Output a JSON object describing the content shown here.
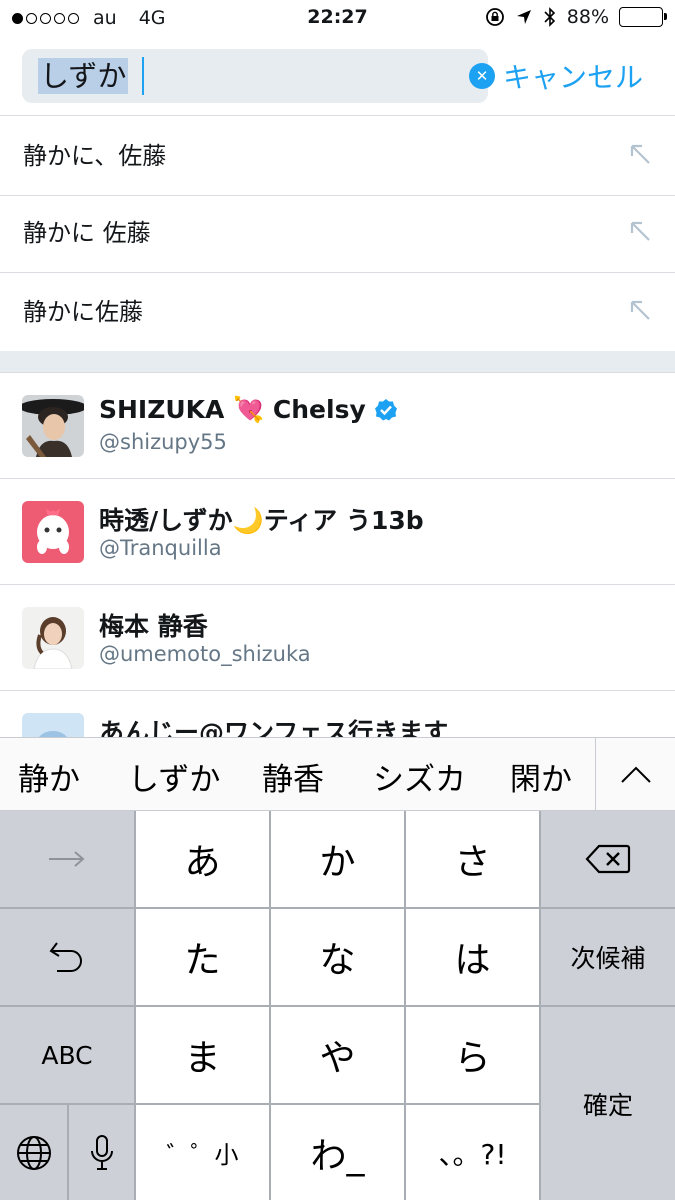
{
  "status_bar": {
    "carrier": "au",
    "network": "4G",
    "time": "22:27",
    "battery": "88%",
    "battery_level": 0.88,
    "signal_bars": 1,
    "signal_total": 5
  },
  "search": {
    "query": "しずか",
    "cancel_label": "キャンセル"
  },
  "suggestions": [
    {
      "label": "静かに、佐藤"
    },
    {
      "label": "静かに 佐藤"
    },
    {
      "label": "静かに佐藤"
    }
  ],
  "users": [
    {
      "name": "SHIZUKA 💘 Chelsy",
      "handle": "@shizupy55",
      "verified": true
    },
    {
      "name": "時透/しずか🌙ティア う13b",
      "handle": "@Tranquilla",
      "verified": false
    },
    {
      "name": "梅本 静香",
      "handle": "@umemoto_shizuka",
      "verified": false
    },
    {
      "name": "あんじー@ワンフェス行きます",
      "handle": "",
      "verified": false
    }
  ],
  "candidates": [
    "静か",
    "しずか",
    "静香",
    "シズカ",
    "閑か"
  ],
  "keyboard": {
    "row1": [
      "→",
      "あ",
      "か",
      "さ",
      "⌫"
    ],
    "row2": [
      "↶",
      "た",
      "な",
      "は",
      "次候補"
    ],
    "row3": [
      "ABC",
      "ま",
      "や",
      "ら"
    ],
    "row4": [
      "🌐",
      "🎤",
      "゛゜小",
      "わ_",
      "、。?!"
    ],
    "confirm": "確定"
  },
  "colors": {
    "accent": "#1da1f2",
    "secondary_text": "#657786",
    "separator": "#e7ecf0"
  }
}
